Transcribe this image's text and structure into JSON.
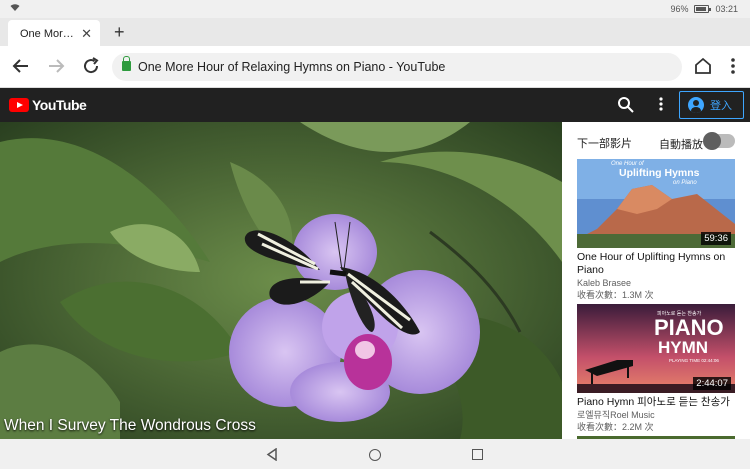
{
  "status_bar": {
    "battery": "96%",
    "time": "03:21"
  },
  "tab": {
    "title": "One Mor…"
  },
  "omnibox": {
    "url": "One More Hour of Relaxing Hymns on Piano - YouTube"
  },
  "youtube": {
    "logo_text": "YouTube",
    "signin_label": "登入"
  },
  "player": {
    "caption": "When I Survey The Wondrous Cross"
  },
  "sidebar": {
    "up_next": "下一部影片",
    "autoplay": "自動播放",
    "autoplay_on": false,
    "videos": [
      {
        "thumb_text_line1": "One Hour of",
        "thumb_text_line2": "Uplifting Hymns",
        "thumb_text_line3": "on Piano",
        "duration": "59:36",
        "title": "One Hour of Uplifting Hymns on Piano",
        "channel": "Kaleb Brasee",
        "views": "收看次數：1.3M 次"
      },
      {
        "thumb_text_line1": "피아노로 듣는 찬송가",
        "thumb_text_line2": "PIANO",
        "thumb_text_line3": "HYMN",
        "thumb_text_line4": "PLAYING TIME 02:44:06",
        "duration": "2:44:07",
        "title": "Piano Hymn 피아노로 듣는 찬송가",
        "channel": "로엘뮤직Roel Music",
        "views": "收看次數：2.2M 次"
      }
    ]
  },
  "colors": {
    "youtube_red": "#ff0000",
    "youtube_dark": "#212121",
    "signin_blue": "#3ea6ff",
    "secure_green": "#2e9b3e"
  }
}
